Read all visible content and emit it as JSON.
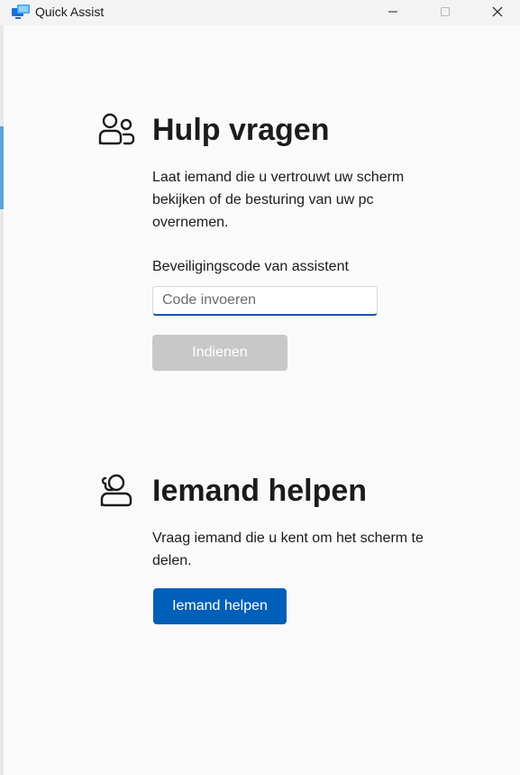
{
  "window": {
    "title": "Quick Assist",
    "icon": "quick-assist-icon",
    "controls": {
      "minimize_icon": "minimize-icon",
      "maximize_icon": "maximize-icon",
      "close_icon": "close-icon"
    }
  },
  "get_help": {
    "icon": "people-icon",
    "title": "Hulp vragen",
    "description": "Laat iemand die u vertrouwt uw scherm bekijken of de besturing van uw pc overnemen.",
    "code_label": "Beveiligingscode van assistent",
    "code_value": "",
    "code_placeholder": "Code invoeren",
    "submit_label": "Indienen"
  },
  "give_help": {
    "icon": "person-headset-icon",
    "title": "Iemand helpen",
    "description": "Vraag iemand die u kent om het scherm te delen.",
    "button_label": "Iemand helpen"
  },
  "colors": {
    "accent": "#005fb8",
    "disabled_button": "#c8c8c8",
    "background": "#fafafa",
    "titlebar": "#f3f3f3"
  }
}
